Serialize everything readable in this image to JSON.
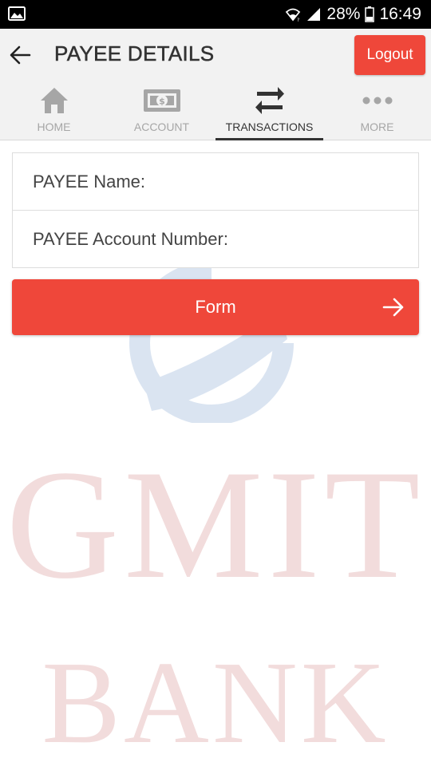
{
  "status_bar": {
    "battery": "28%",
    "time": "16:49",
    "icons": [
      "image-icon",
      "wifi-icon",
      "signal-icon",
      "battery-icon"
    ]
  },
  "app_bar": {
    "title": "PAYEE DETAILS",
    "logout_label": "Logout",
    "back_icon": "arrow-left-icon"
  },
  "tabs": [
    {
      "label": "HOME",
      "icon": "home-icon",
      "active": false
    },
    {
      "label": "ACCOUNT",
      "icon": "cash-icon",
      "active": false
    },
    {
      "label": "TRANSACTIONS",
      "icon": "swap-arrows-icon",
      "active": true
    },
    {
      "label": "MORE",
      "icon": "more-dots-icon",
      "active": false
    }
  ],
  "form": {
    "payee_name_label": "PAYEE Name:",
    "payee_account_label": "PAYEE Account Number:"
  },
  "form_button": {
    "label": "Form",
    "icon": "arrow-right-icon"
  },
  "watermark": {
    "line1": "GMIT",
    "line2": "BANK"
  },
  "colors": {
    "accent": "#ef473a",
    "app_bar_bg": "#f2f2f2",
    "tab_inactive": "#a6a6a6",
    "tab_active": "#333333"
  }
}
